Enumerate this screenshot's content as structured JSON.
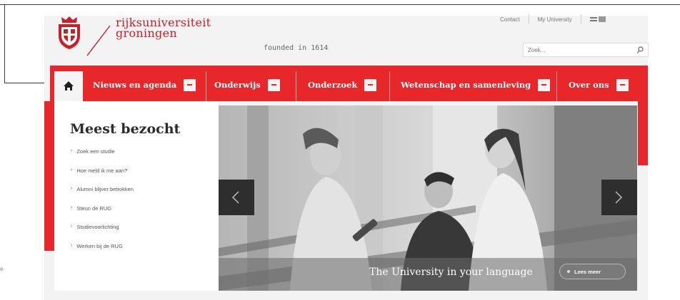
{
  "brand": {
    "name_line1": "rijksuniversiteit",
    "name_line2": "groningen",
    "tagline": "founded in 1614",
    "accent_color": "#e8272b"
  },
  "header": {
    "top_links": [
      "Contact",
      "My University"
    ],
    "language_icon": "language-flag-icon",
    "search": {
      "placeholder": "Zoek...",
      "icon": "search-icon"
    }
  },
  "nav": {
    "home_icon": "home-icon",
    "items": [
      {
        "label": "Nieuws en agenda"
      },
      {
        "label": "Onderwijs"
      },
      {
        "label": "Onderzoek"
      },
      {
        "label": "Wetenschap en samenleving"
      },
      {
        "label": "Over ons"
      }
    ]
  },
  "sidebar": {
    "title": "Meest bezocht",
    "links": [
      "Zoek een studie",
      "Hoe meld ik me aan?",
      "Alumni blijver betrokken",
      "Steun de RUG",
      "Studievoorlichting",
      "Werken bij de RUG"
    ]
  },
  "hero": {
    "caption": "The University in your language",
    "button": "Lees meer",
    "prev_icon": "chevron-left-icon",
    "next_icon": "chevron-right-icon"
  },
  "margin_mark": "e"
}
